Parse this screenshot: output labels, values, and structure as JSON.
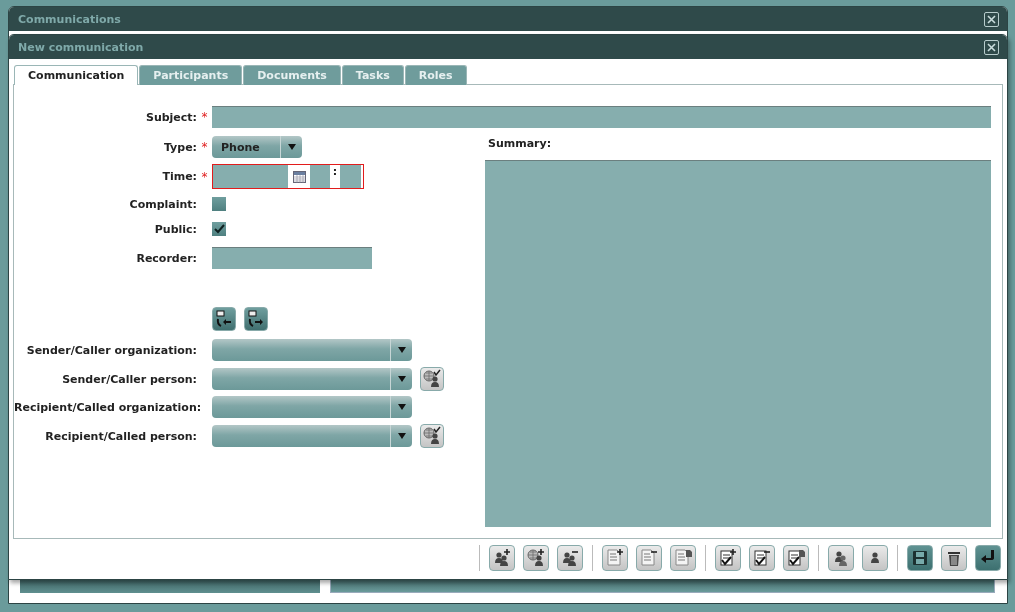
{
  "outer_window": {
    "title": "Communications"
  },
  "dialog": {
    "title": "New communication"
  },
  "tabs": [
    {
      "label": "Communication",
      "selected": true
    },
    {
      "label": "Participants",
      "selected": false
    },
    {
      "label": "Documents",
      "selected": false
    },
    {
      "label": "Tasks",
      "selected": false
    },
    {
      "label": "Roles",
      "selected": false
    }
  ],
  "required_mark": "*",
  "time_separator": ":",
  "subject": {
    "label": "Subject:",
    "required": true
  },
  "fields": [
    {
      "kind": "select",
      "label": "Type:",
      "required": true,
      "value": "Phone"
    },
    {
      "kind": "datetime",
      "label": "Time:",
      "required": true,
      "invalid": true
    },
    {
      "kind": "checkbox",
      "label": "Complaint:",
      "required": false,
      "checked": false
    },
    {
      "kind": "checkbox",
      "label": "Public:",
      "required": false,
      "checked": true
    },
    {
      "kind": "text",
      "label": "Recorder:",
      "required": false
    }
  ],
  "direction_buttons": [
    {
      "kind": "incoming"
    },
    {
      "kind": "outgoing"
    }
  ],
  "parties": [
    {
      "label": "Sender/Caller organization:",
      "pick_button": false
    },
    {
      "label": "Sender/Caller person:",
      "pick_button": true
    },
    {
      "label": "Recipient/Called organization:",
      "pick_button": false
    },
    {
      "label": "Recipient/Called person:",
      "pick_button": true
    }
  ],
  "summary": {
    "label": "Summary:"
  },
  "toolbar": [
    [
      {
        "kind": "group-add",
        "highlighted": false
      },
      {
        "kind": "globe-add",
        "highlighted": false
      },
      {
        "kind": "group-remove",
        "highlighted": false
      }
    ],
    [
      {
        "kind": "doc-add",
        "highlighted": false
      },
      {
        "kind": "doc-remove",
        "highlighted": false
      },
      {
        "kind": "doc-copy",
        "highlighted": false
      }
    ],
    [
      {
        "kind": "task-add",
        "highlighted": false
      },
      {
        "kind": "task-remove",
        "highlighted": false
      },
      {
        "kind": "task-copy",
        "highlighted": false
      }
    ],
    [
      {
        "kind": "group",
        "highlighted": false
      },
      {
        "kind": "person",
        "highlighted": false
      }
    ],
    [
      {
        "kind": "save",
        "highlighted": true
      },
      {
        "kind": "trash",
        "highlighted": false
      },
      {
        "kind": "back",
        "highlighted": true
      }
    ]
  ]
}
